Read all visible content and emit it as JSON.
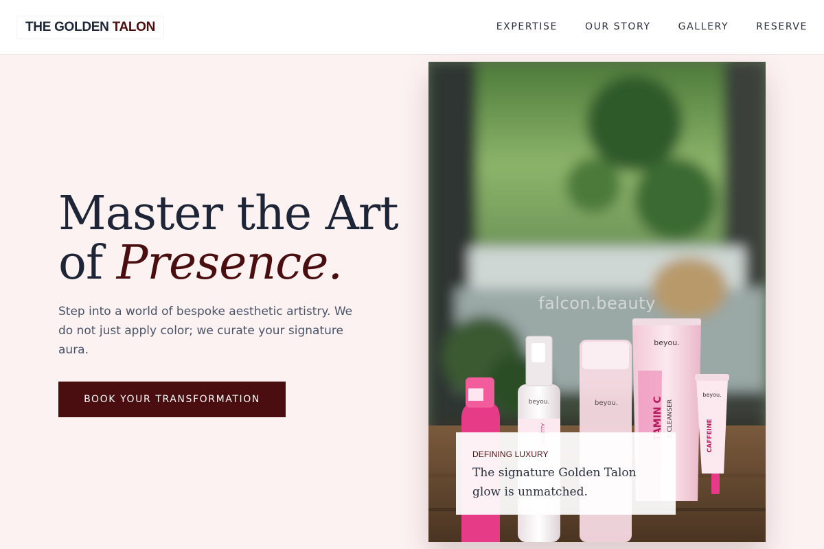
{
  "brand": {
    "name_part1": "THE GOLDEN",
    "name_part2": "TALON"
  },
  "nav": {
    "items": [
      "EXPERTISE",
      "OUR STORY",
      "GALLERY",
      "RESERVE"
    ]
  },
  "hero": {
    "title_line1": "Master the Art",
    "title_line2_prefix": "of ",
    "title_line2_emphasis": "Presence.",
    "subtitle": "Step into a world of bespoke aesthetic artistry. We do not just apply color; we curate your signature aura.",
    "cta_label": "BOOK YOUR TRANSFORMATION"
  },
  "photo": {
    "watermark": "falcon.beauty",
    "product_brand": "beyou.",
    "tube_label": "TAMIN C",
    "tube_sublabel": "E CLEANSER",
    "small_tube_label": "CAFFEINE",
    "bottle_label": "ALURONIC"
  },
  "caption": {
    "kicker": "DEFINING LUXURY",
    "quote": "The signature Golden Talon glow is unmatched."
  },
  "colors": {
    "accent": "#4a0e10",
    "navy": "#1e2537",
    "page_bg": "#fdf2f2"
  }
}
